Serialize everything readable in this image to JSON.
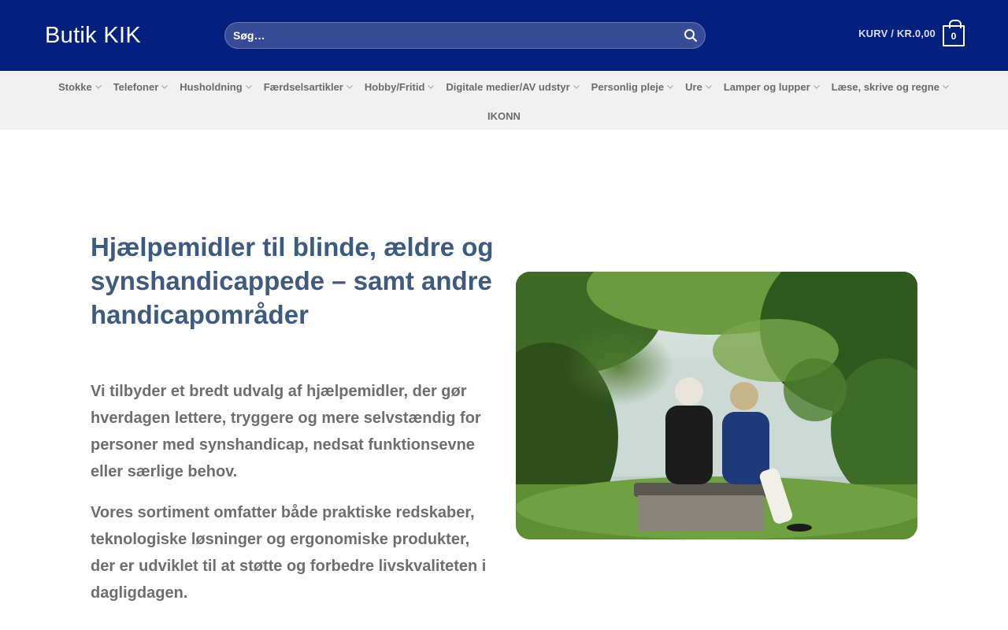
{
  "header": {
    "logo": "Butik KIK",
    "search_placeholder": "Søg…",
    "cart_label": "KURV / KR.0,00",
    "cart_count": "0"
  },
  "nav": {
    "items": [
      {
        "label": "Stokke"
      },
      {
        "label": "Telefoner"
      },
      {
        "label": "Husholdning"
      },
      {
        "label": "Færdselsartikler"
      },
      {
        "label": "Hobby/Fritid"
      },
      {
        "label": "Digitale medier/AV udstyr"
      },
      {
        "label": "Personlig pleje"
      },
      {
        "label": "Ure"
      },
      {
        "label": "Lamper og lupper"
      },
      {
        "label": "Læse, skrive og regne"
      }
    ],
    "extra": "IKONN"
  },
  "content": {
    "title": "Hjælpemidler til blinde, ældre og synshandicappede – samt andre handicapområder",
    "paragraph1": "Vi tilbyder et bredt udvalg af hjælpemidler, der gør hverdagen lettere, tryggere og mere selvstændig for personer med synshandicap, nedsat funktionsevne eller særlige behov.",
    "paragraph2": "Vores sortiment omfatter både praktiske redskaber, teknologiske løsninger og ergonomiske produkter, der er udviklet til at støtte og forbedre livskvaliteten i dagligdagen."
  },
  "colors": {
    "header_bg": "#04207f",
    "nav_bg": "#f1f1f1",
    "title": "#3d5a80",
    "body_text": "#6e6e6e"
  }
}
